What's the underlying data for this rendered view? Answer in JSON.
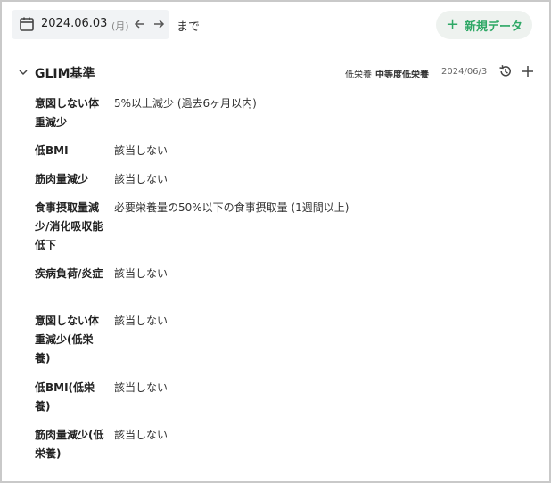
{
  "date_filter": {
    "date": "2024.06.03",
    "weekday": "(月)",
    "suffix": "まで"
  },
  "new_button": {
    "plus": "+",
    "label": "新規データ"
  },
  "section": {
    "title": "GLIM基準",
    "severity_label": "低栄養",
    "severity_value": "中等度低栄養",
    "date": "2024/06/3"
  },
  "rows": [
    {
      "label": "意図しない体重減少",
      "value": "5%以上減少 (過去6ヶ月以内)"
    },
    {
      "label": "低BMI",
      "value": "該当しない"
    },
    {
      "label": "筋肉量減少",
      "value": "該当しない"
    },
    {
      "label": "食事摂取量減少/消化吸収能低下",
      "value": "必要栄養量の50%以下の食事摂取量 (1週間以上)"
    },
    {
      "label": "疾病負荷/炎症",
      "value": "該当しない"
    },
    {
      "label": "意図しない体重減少(低栄養)",
      "value": "該当しない"
    },
    {
      "label": "低BMI(低栄養)",
      "value": "該当しない"
    },
    {
      "label": "筋肉量減少(低栄養)",
      "value": "該当しない"
    }
  ],
  "icons": {
    "calendar": "calendar-icon",
    "prev": "arrow-left-icon",
    "next": "arrow-right-icon",
    "collapse": "chevron-down-icon",
    "history": "history-icon",
    "add": "plus-icon"
  },
  "colors": {
    "accent": "#2fa866",
    "date_box_bg": "#f1f3f5"
  }
}
